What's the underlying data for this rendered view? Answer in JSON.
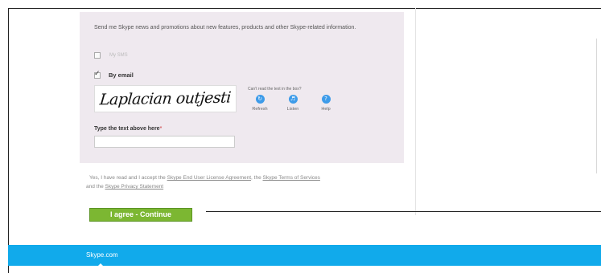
{
  "promo": {
    "text": "Send me Skype news and promotions about new features, products and other Skype-related information."
  },
  "options": {
    "sms_label": "My SMS",
    "email_label": "By email",
    "sms_checked": false,
    "email_checked": true
  },
  "captcha": {
    "image_text": "Laplacian outjesti",
    "cant_read": "Can't read the text in the box?",
    "refresh_label": "Refresh",
    "listen_label": "Listen",
    "help_label": "Help",
    "refresh_icon": "refresh-icon",
    "listen_icon": "speaker-icon",
    "help_icon": "help-icon",
    "input_label": "Type the text above here",
    "required_mark": "*",
    "input_value": "",
    "input_placeholder": ""
  },
  "legal": {
    "prefix": "Yes, I have read and I accept the ",
    "eula": "Skype End User License Agreement",
    "sep1": ", the ",
    "terms": "Skype Terms of Services",
    "sep2": " and the ",
    "privacy": "Skype Privacy Statement"
  },
  "continue_label": "I agree - Continue",
  "footer": {
    "link": "Skype.com"
  },
  "colors": {
    "panel_bg": "#efe9ef",
    "accent_green": "#7cb732",
    "footer_blue": "#11aaeb",
    "icon_blue": "#3d9be9"
  }
}
